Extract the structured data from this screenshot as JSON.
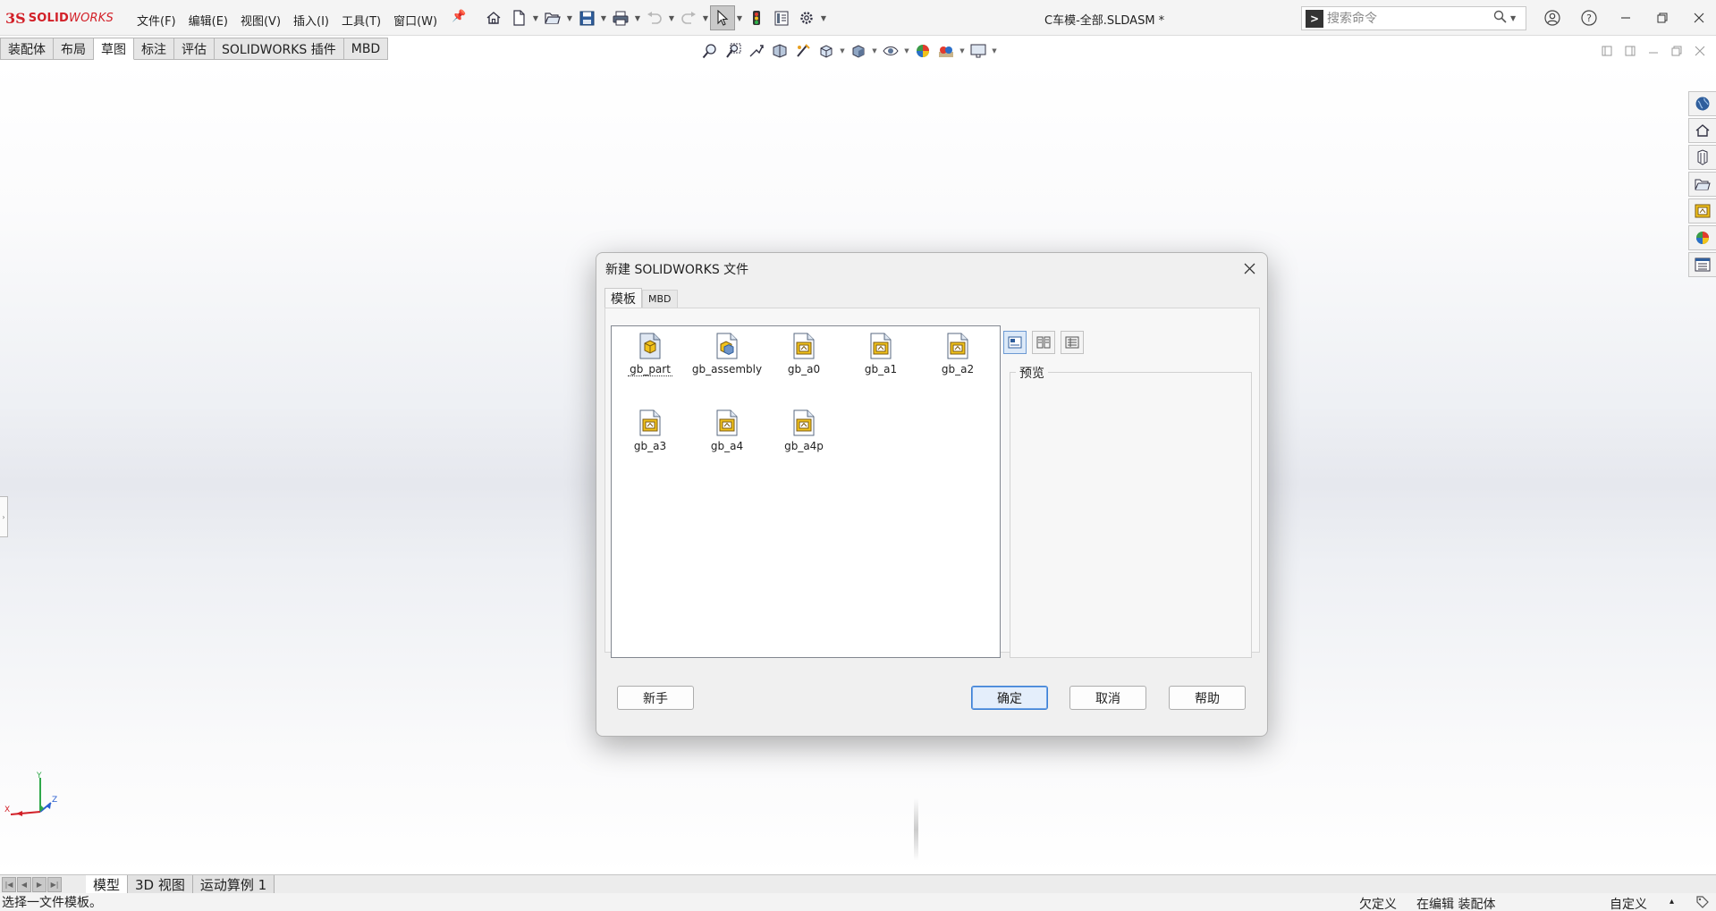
{
  "app": {
    "logo_mark": "3S",
    "logo_text_bold": "SOLID",
    "logo_text_italic": "WORKS",
    "document_title": "C车模-全部.SLDASM *"
  },
  "menu": {
    "items": [
      "文件(F)",
      "编辑(E)",
      "视图(V)",
      "插入(I)",
      "工具(T)",
      "窗口(W)"
    ]
  },
  "search": {
    "placeholder": "搜索命令"
  },
  "command_tabs": [
    "装配体",
    "布局",
    "草图",
    "标注",
    "评估",
    "SOLIDWORKS 插件",
    "MBD"
  ],
  "bottom_tabs": [
    "模型",
    "3D 视图",
    "运动算例 1"
  ],
  "status": {
    "message": "选择一文件模板。",
    "definition": "欠定义",
    "editing": "在编辑 装配体",
    "custom": "自定义",
    "caret": "▴"
  },
  "triad": {
    "x": "X",
    "y": "Y",
    "z": "Z"
  },
  "dialog": {
    "title": "新建 SOLIDWORKS 文件",
    "tabs": [
      "模板",
      "MBD"
    ],
    "templates": [
      {
        "name": "gb_part",
        "kind": "part"
      },
      {
        "name": "gb_assembly",
        "kind": "assembly"
      },
      {
        "name": "gb_a0",
        "kind": "drawing"
      },
      {
        "name": "gb_a1",
        "kind": "drawing"
      },
      {
        "name": "gb_a2",
        "kind": "drawing"
      },
      {
        "name": "gb_a3",
        "kind": "drawing"
      },
      {
        "name": "gb_a4",
        "kind": "drawing"
      },
      {
        "name": "gb_a4p",
        "kind": "drawing"
      }
    ],
    "selected_template": "gb_part",
    "preview_label": "预览",
    "buttons": {
      "novice": "新手",
      "ok": "确定",
      "cancel": "取消",
      "help": "帮助"
    }
  },
  "colors": {
    "brand": "#d22028",
    "default_button_border": "#3b7fd4"
  }
}
